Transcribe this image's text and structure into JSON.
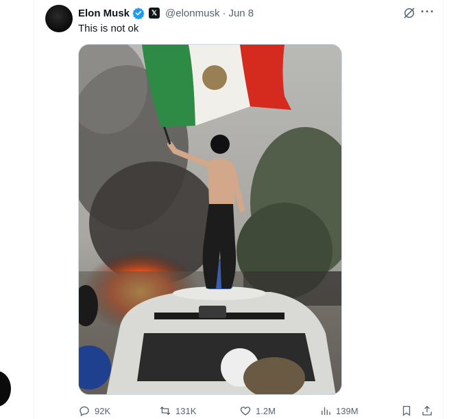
{
  "tweet": {
    "author_name": "Elon Musk",
    "handle": "@elonmusk",
    "separator": "·",
    "date": "Jun 8",
    "text": "This is not ok",
    "verified_color": "#1d9bf0"
  },
  "media": {
    "kind": "photo"
  },
  "actions": {
    "replies": "92K",
    "reposts": "131K",
    "likes": "1.2M",
    "views": "139M"
  },
  "icons": [
    "verified-badge-icon",
    "x-affiliate-icon",
    "grok-icon",
    "more-icon",
    "reply-icon",
    "repost-icon",
    "like-icon",
    "views-icon",
    "bookmark-icon",
    "share-icon"
  ]
}
